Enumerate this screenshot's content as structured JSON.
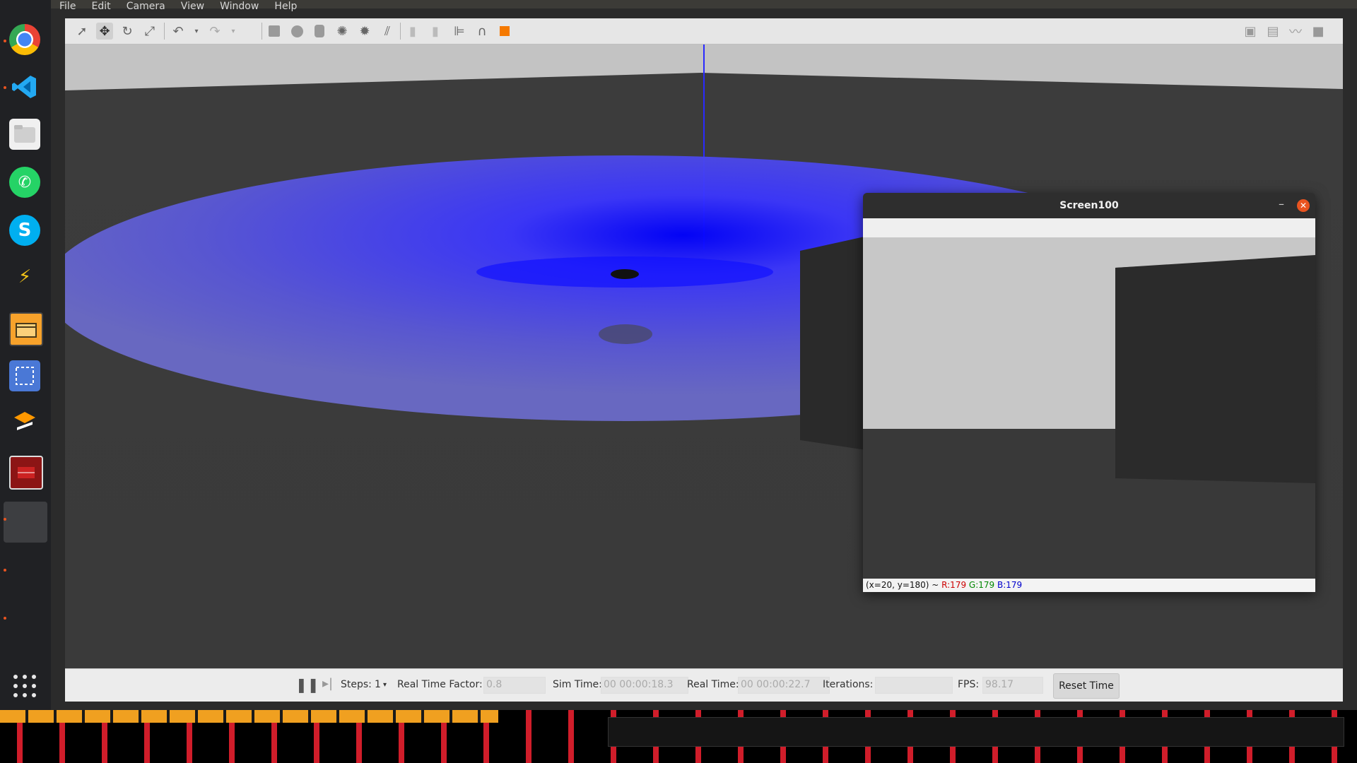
{
  "menu": [
    "File",
    "Edit",
    "Camera",
    "View",
    "Window",
    "Help"
  ],
  "toolbar": {
    "tools": [
      "select-arrow-icon",
      "translate-icon",
      "rotate-icon",
      "scale-icon",
      "undo-icon",
      "dropdown-arrow-icon",
      "redo-icon",
      "dropdown-arrow-icon",
      "box-icon",
      "sphere-icon",
      "cylinder-icon",
      "point-light-icon",
      "spot-light-icon",
      "directional-light-icon",
      "copy-icon",
      "paste-icon",
      "align-icon",
      "snap-icon",
      "orange-view-icon"
    ],
    "right_tools": [
      "screenshot-icon",
      "log-icon",
      "plot-icon",
      "video-record-icon"
    ]
  },
  "floating_window": {
    "title": "Screen100",
    "status": {
      "coords": "(x=20, y=180) ~ ",
      "r": "R:179",
      "g": "G:179",
      "b": "B:179"
    }
  },
  "bottom_bar": {
    "steps_label": "Steps:",
    "steps_value": "1",
    "rtf_label": "Real Time Factor:",
    "rtf_value": "0.8",
    "sim_time_label": "Sim Time:",
    "sim_time_value": "00 00:00:18.3",
    "real_time_label": "Real Time:",
    "real_time_value": "00 00:00:22.7",
    "iterations_label": "Iterations:",
    "fps_label": "FPS:",
    "fps_value": "98.17",
    "reset_label": "Reset Time"
  },
  "colors": {
    "dock_bg": "#202124",
    "accent": "#e95420",
    "laser_blue": "#3333ff",
    "status_r": "#cc0000",
    "status_g": "#008800",
    "status_b": "#0000cc"
  }
}
